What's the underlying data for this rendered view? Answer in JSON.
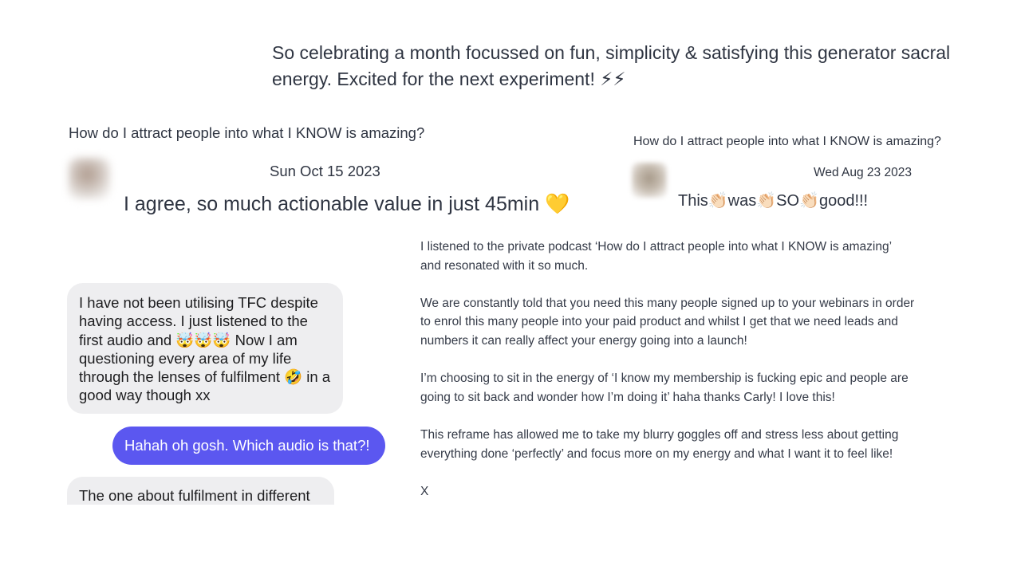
{
  "celebration": {
    "text": "So celebrating a month focussed on fun, simplicity & satisfying this generator sacral energy. Excited for the next experiment! ⚡⚡"
  },
  "left_card": {
    "title": "How do I attract people into what I KNOW is amazing?",
    "date": "Sun Oct 15 2023",
    "comment": "I agree, so much actionable value in just 45min 💛"
  },
  "right_card": {
    "title": "How do I attract people into what I KNOW is amazing?",
    "date": "Wed Aug 23 2023",
    "comment": "This👏🏻was👏🏻SO👏🏻good!!!"
  },
  "testimonial": {
    "paragraphs": [
      "I listened to the private podcast ‘How do I attract people into what I KNOW is amazing’ and resonated with it so much.",
      "We are constantly told that you need this many people signed up to your webinars in order to enrol this many people into your paid product and whilst I get that we need leads and numbers it can really affect your energy going into a launch!",
      "I’m choosing to sit in the energy of ‘I know my membership is fucking epic and people are going to sit back and wonder how I’m doing it’ haha thanks Carly! I love this!",
      "This reframe has allowed me to take my blurry goggles off and stress less about getting everything done ‘perfectly’ and focus more on my energy and what I want it to feel like!",
      "X"
    ]
  },
  "chat": {
    "messages": [
      {
        "sender": "them",
        "text": "I have not been utilising TFC despite having access. I just listened to the first audio and 🤯🤯🤯 Now I am questioning every area of my life through the lenses of fulfilment 🤣 in a good way though xx"
      },
      {
        "sender": "me",
        "text": "Hahah oh gosh. Which audio is that?!"
      },
      {
        "sender": "them",
        "text": "The one about fulfilment in different"
      }
    ]
  },
  "colors": {
    "sent_bubble": "#5b57f0",
    "received_bubble": "#eeeef0",
    "text": "#2f3542"
  }
}
